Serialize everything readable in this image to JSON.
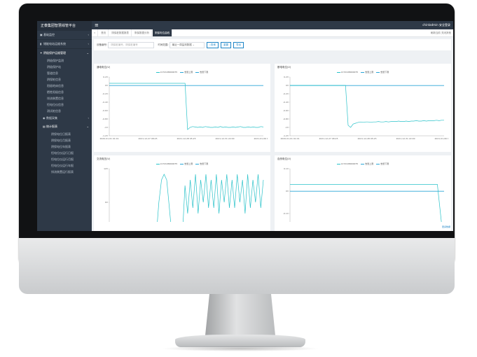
{
  "brand": "正泰集团智慧综管平台",
  "topbar": {
    "menu_icon": "hamburger-icon",
    "user": "chintadmin 安全登录"
  },
  "sidebar": {
    "items": [
      {
        "label": "基础监控",
        "icon": "monitor-icon"
      },
      {
        "label": "储能电站运维系统",
        "icon": "battery-icon"
      },
      {
        "label": "阴极保护运维管理",
        "icon": "shield-icon"
      }
    ],
    "sub_items": [
      "阴极保护监测",
      "阴极保护站",
      "管道信息",
      "阴保桩信息",
      "阳极地床信息",
      "牺牲阳极信息",
      "排流装置信息",
      "恒电位仪信息",
      "测试桩信息"
    ],
    "groups": [
      {
        "label": "数据采集",
        "icon": "database-icon"
      },
      {
        "label": "统计报表",
        "icon": "chart-icon"
      }
    ],
    "report_items": [
      "阴保电位日报表",
      "阴保电位月报表",
      "阴保电位年报表",
      "恒电位仪运行日报",
      "恒电位仪运行月报",
      "恒电位仪运行年报",
      "排流装置运行报表"
    ]
  },
  "tabs": [
    "首页",
    "阴保桩数据报表",
    "阴保数据分析",
    "阴保电位曲线"
  ],
  "tab_right": "刷新当前 关闭其他",
  "filter": {
    "label1": "设备编号:",
    "placeholder1": "阴保桩编号、阴保桩编号",
    "label2": "时间范围:",
    "select": "最近一周监测数据",
    "btn_search": "查询",
    "btn_reset": "重置",
    "btn_export": "导出"
  },
  "panels": [
    {
      "title": "通电电位(V)"
    },
    {
      "title": "断电电位(V)"
    },
    {
      "title": "交流电压(V)"
    },
    {
      "title": "自然电位(V)"
    }
  ],
  "legend": {
    "series": "z172108000075",
    "upper": "告警上限",
    "lower": "告警下限"
  },
  "footer_link": "更多数据",
  "colors": {
    "series": "#29c2c9",
    "limit": "#2aa6d8",
    "sidebar": "#2e3947",
    "accent": "#1c84c6"
  },
  "chart_data": [
    {
      "type": "line",
      "title": "通电电位(V)",
      "ylim": [
        -1.2,
        0.2
      ],
      "y_ticks": [
        "0.2V",
        "0V",
        "-0.2V",
        "-0.4V",
        "-0.6V",
        "-0.8V",
        "-1V",
        "-1.2V"
      ],
      "x_ticks": [
        "2020-01-01 01:01",
        "2021-12-27 08:25",
        "2021-12-28 05:25",
        "2021-12-31 22:00",
        "2021-01-06 19:00"
      ],
      "series": [
        {
          "name": "z172108000075",
          "values": [
            0.05,
            0.05,
            0.05,
            0.05,
            0.05,
            0.05,
            0.05,
            0.05,
            0.05,
            0.05,
            0.05,
            0.05,
            0.05,
            0.05,
            0.05,
            0.05,
            0.05,
            0.05,
            0.05,
            0.05,
            0.05,
            0.05,
            0.05,
            0.05,
            0.05,
            0.05,
            0.05,
            0.05,
            0.05,
            0.05,
            0.05,
            -1.05,
            -1.0,
            -0.98,
            -0.99,
            -1.0,
            -0.99,
            -1.0,
            -0.98,
            -0.99,
            -1.0,
            -1.0,
            -0.99,
            -1.0,
            -0.98,
            -1.0,
            -0.99,
            -1.0,
            -1.0,
            -0.99,
            -1.0,
            -0.99,
            -0.98,
            -1.0,
            -1.0,
            -0.99,
            -1.0,
            -0.99,
            -1.0,
            -1.0,
            -0.98,
            -0.99
          ]
        },
        {
          "name": "告警上限",
          "values": [
            0,
            0
          ]
        },
        {
          "name": "告警下限",
          "values": [
            0,
            0
          ]
        }
      ]
    },
    {
      "type": "line",
      "title": "断电电位(V)",
      "ylim": [
        -1.2,
        0.2
      ],
      "y_ticks": [
        "0.2V",
        "0V",
        "-0.2V",
        "-0.4V",
        "-0.6V",
        "-0.8V",
        "-1V",
        "-1.2V"
      ],
      "x_ticks": [
        "2020-01-01 01:01",
        "2021-12-27 08:25",
        "2021-12-28 05:25",
        "2021-12-31 22:00",
        "2021-01-06 19:00"
      ],
      "series": [
        {
          "name": "z172108000075",
          "values": [
            0,
            0,
            0,
            0,
            0,
            0,
            0,
            0,
            0,
            0,
            0,
            0,
            0,
            0,
            0,
            0,
            0,
            0,
            0,
            0,
            0,
            0,
            0,
            -0.95,
            -1.0,
            -0.92,
            -0.9,
            -0.88,
            -0.87,
            -0.88,
            -0.87,
            -0.87,
            -0.88,
            -0.87,
            -0.87,
            -0.86,
            -0.87,
            -0.87,
            -0.86,
            -0.87,
            -0.86,
            -0.86,
            -0.86,
            -0.85,
            -0.86,
            -0.86,
            -0.85,
            -0.86,
            -0.85,
            -0.85,
            -0.84,
            -0.85,
            -0.85,
            -0.84,
            -0.85,
            -0.84,
            -0.84,
            -0.84,
            -0.83,
            -0.84,
            -0.83,
            -0.83
          ]
        },
        {
          "name": "告警上限",
          "values": [
            0,
            0
          ]
        },
        {
          "name": "告警下限",
          "values": [
            0,
            0
          ]
        }
      ]
    },
    {
      "type": "line",
      "title": "交流电压(V)",
      "ylim": [
        0,
        12
      ],
      "y_ticks": [
        "12V",
        "6V",
        "0V"
      ],
      "x_ticks": [],
      "series": [
        {
          "name": "z172108000075",
          "values": [
            0,
            0,
            0,
            0,
            0,
            0,
            0,
            0,
            0,
            0,
            0,
            0,
            0,
            0,
            0,
            0,
            0,
            0,
            0,
            6,
            10,
            11,
            10,
            5,
            0,
            0,
            0,
            0,
            0,
            9,
            4,
            10,
            5,
            11,
            4,
            10,
            6,
            11,
            5,
            10,
            5,
            11,
            4,
            10,
            6,
            11,
            5,
            10,
            5,
            11,
            6,
            10,
            4,
            11,
            5,
            10,
            6,
            11,
            5,
            10
          ]
        },
        {
          "name": "告警上限",
          "values": [
            0,
            0
          ]
        },
        {
          "name": "告警下限",
          "values": [
            0,
            0
          ]
        }
      ]
    },
    {
      "type": "line",
      "title": "自然电位(V)",
      "ylim": [
        -0.2,
        0.1
      ],
      "y_ticks": [
        "0.1V",
        "0V",
        "-0.1V",
        "-0.2V"
      ],
      "x_ticks": [],
      "series": [
        {
          "name": "z172108000075",
          "values": [
            0.03,
            0.03,
            0.03,
            0.03,
            0.03,
            0.03,
            0.03,
            0.03,
            0.03,
            0.03,
            0.03,
            0.03,
            0.03,
            0.03,
            0.03,
            0.03,
            0.03,
            0.03,
            0.03,
            0.03,
            0.03,
            0.03,
            0.03,
            -0.25
          ]
        },
        {
          "name": "告警上限",
          "values": [
            0,
            0
          ]
        },
        {
          "name": "告警下限",
          "values": [
            0,
            0
          ]
        }
      ]
    }
  ]
}
